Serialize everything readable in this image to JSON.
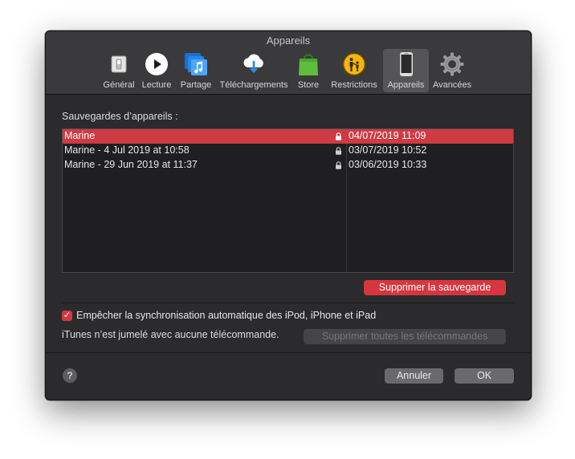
{
  "window": {
    "title": "Appareils"
  },
  "tabs": [
    {
      "label": "Général",
      "icon": "switch-icon"
    },
    {
      "label": "Lecture",
      "icon": "play-icon"
    },
    {
      "label": "Partage",
      "icon": "music-share-icon"
    },
    {
      "label": "Téléchargements",
      "icon": "cloud-download-icon"
    },
    {
      "label": "Store",
      "icon": "shopping-bag-icon"
    },
    {
      "label": "Restrictions",
      "icon": "parental-restrictions-icon"
    },
    {
      "label": "Appareils",
      "icon": "iphone-icon"
    },
    {
      "label": "Avancées",
      "icon": "gear-icon"
    }
  ],
  "active_tab": "Appareils",
  "backups": {
    "section_label": "Sauvegardes d’appareils :",
    "rows": [
      {
        "name": "Marine",
        "date": "04/07/2019 11:09",
        "locked": true,
        "selected": true
      },
      {
        "name": "Marine - 4 Jul 2019 at 10:58",
        "date": "03/07/2019 10:52",
        "locked": true,
        "selected": false
      },
      {
        "name": "Marine - 29 Jun 2019 at 11:37",
        "date": "03/06/2019 10:33",
        "locked": true,
        "selected": false
      }
    ],
    "delete_label": "Supprimer la sauvegarde"
  },
  "sync": {
    "prevent_label": "Empêcher la synchronisation automatique des iPod, iPhone et iPad",
    "prevent_checked": true
  },
  "remote": {
    "status_text": "iTunes n’est jumelé avec aucune télécommande.",
    "remove_all_label": "Supprimer toutes les télécommandes"
  },
  "footer": {
    "help_label": "?",
    "cancel_label": "Annuler",
    "ok_label": "OK"
  },
  "colors": {
    "accent": "#d6363f",
    "window_bg": "#2b2b2d",
    "toolbar_bg": "#3a3a3c",
    "list_bg": "#1f1f21"
  }
}
